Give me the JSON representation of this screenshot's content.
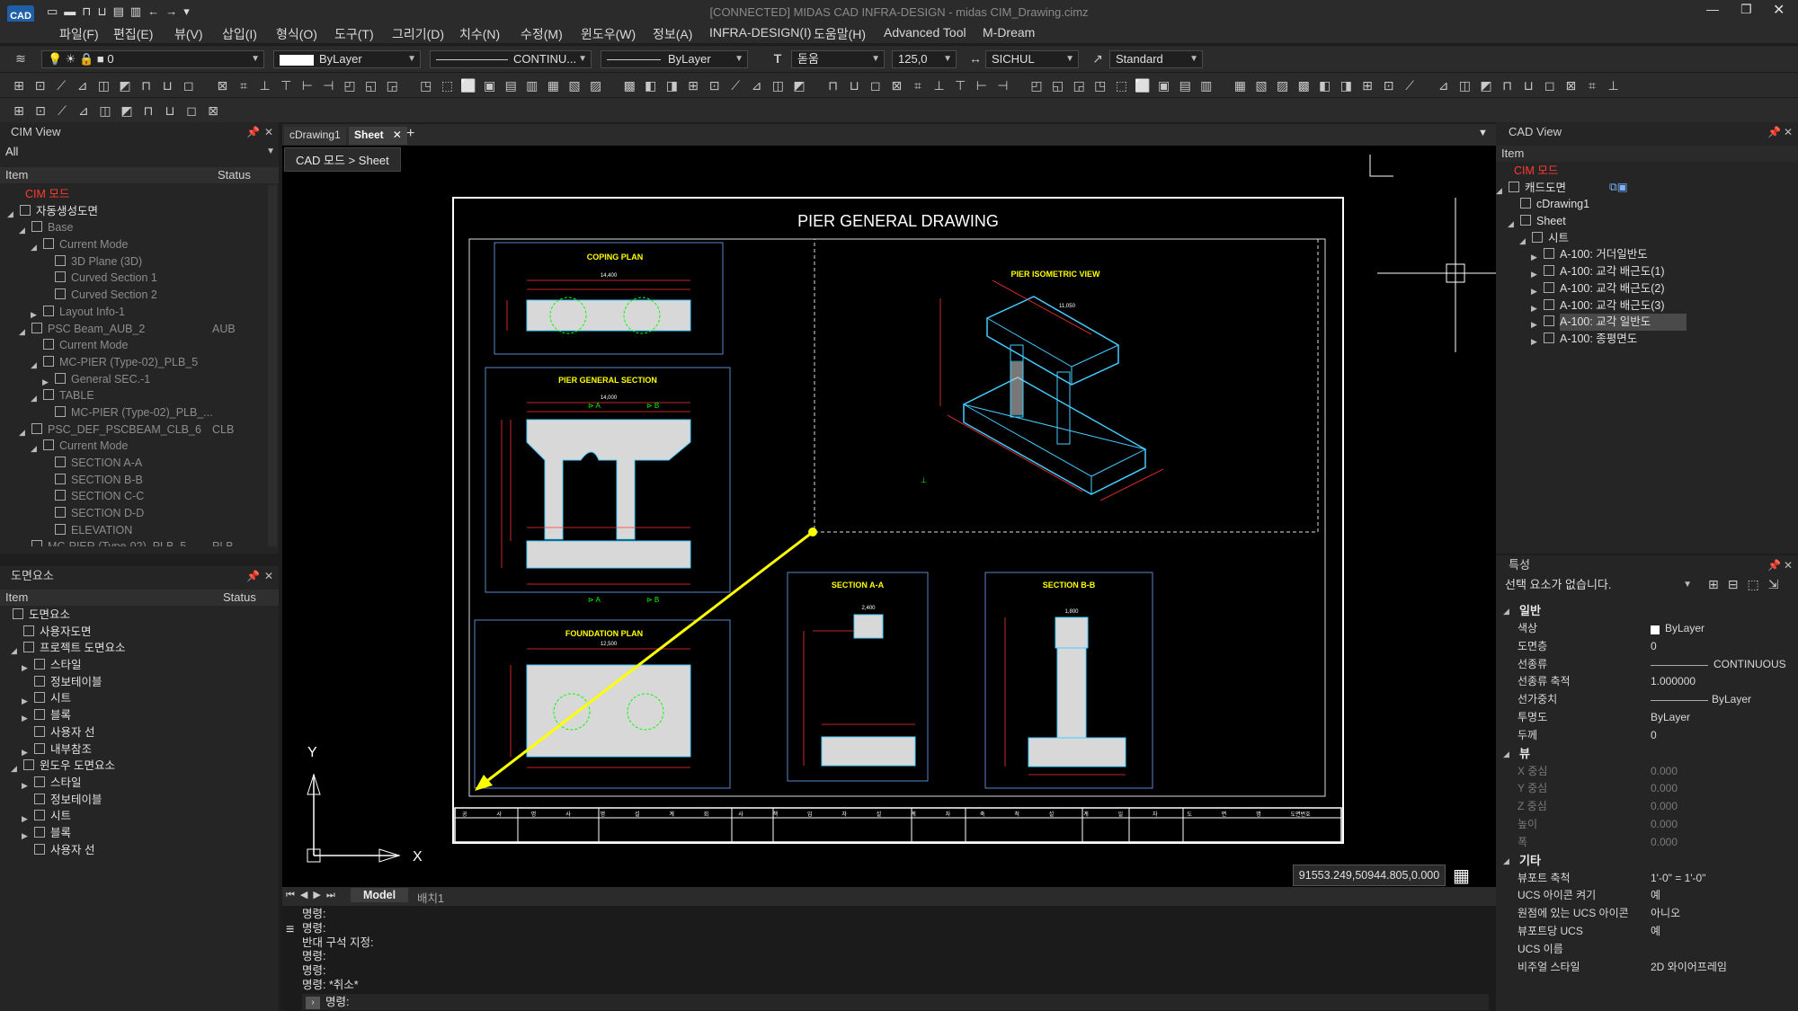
{
  "app": {
    "title": "[CONNECTED] MIDAS CAD INFRA-DESIGN - midas CIM_Drawing.cimz",
    "logo": "CAD"
  },
  "menu": [
    "파일(F)",
    "편집(E)",
    "뷰(V)",
    "삽입(I)",
    "형식(O)",
    "도구(T)",
    "그리기(D)",
    "치수(N)",
    "수정(M)",
    "윈도우(W)",
    "정보(A)",
    "INFRA-DESIGN(I)",
    "도움말(H)",
    "Advanced Tool",
    "M-Dream"
  ],
  "props_toolbar": {
    "layer": "0",
    "color": "ByLayer",
    "linetype": "CONTINU...",
    "lineweight": "ByLayer",
    "textstyle": "돋움",
    "textheight": "125,0",
    "dimstyle": "SICHUL",
    "mlstyle": "Standard"
  },
  "cim_view": {
    "title": "CIM View",
    "filter": "All",
    "col_item": "Item",
    "col_status": "Status",
    "items": [
      {
        "label": "CIM 모드",
        "status": "",
        "level": 1,
        "red": true,
        "tri": "",
        "dim": false
      },
      {
        "label": "자동생성도면",
        "status": "",
        "level": 1,
        "tri": "◢",
        "dim": false
      },
      {
        "label": "Base",
        "status": "",
        "level": 2,
        "tri": "◢",
        "dim": true
      },
      {
        "label": "Current Mode",
        "status": "",
        "level": 3,
        "tri": "◢",
        "dim": true
      },
      {
        "label": "3D Plane (3D)",
        "status": "",
        "level": 4,
        "tri": "",
        "dim": true
      },
      {
        "label": "Curved Section 1",
        "status": "",
        "level": 4,
        "tri": "",
        "dim": true
      },
      {
        "label": "Curved Section 2",
        "status": "",
        "level": 4,
        "tri": "",
        "dim": true
      },
      {
        "label": "Layout Info-1",
        "status": "",
        "level": 3,
        "tri": "▶",
        "dim": true
      },
      {
        "label": "PSC Beam_AUB_2",
        "status": "AUB",
        "level": 2,
        "tri": "◢",
        "dim": true
      },
      {
        "label": "Current Mode",
        "status": "",
        "level": 3,
        "tri": "",
        "dim": true
      },
      {
        "label": "MC-PIER (Type-02)_PLB_5",
        "status": "",
        "level": 3,
        "tri": "◢",
        "dim": true
      },
      {
        "label": "General SEC.-1",
        "status": "",
        "level": 4,
        "tri": "▶",
        "dim": true
      },
      {
        "label": "TABLE",
        "status": "",
        "level": 3,
        "tri": "◢",
        "dim": true
      },
      {
        "label": "MC-PIER (Type-02)_PLB_...",
        "status": "",
        "level": 4,
        "tri": "",
        "dim": true
      },
      {
        "label": "PSC_DEF_PSCBEAM_CLB_6",
        "status": "CLB",
        "level": 2,
        "tri": "◢",
        "dim": true
      },
      {
        "label": "Current Mode",
        "status": "",
        "level": 3,
        "tri": "◢",
        "dim": true
      },
      {
        "label": "SECTION A-A",
        "status": "",
        "level": 4,
        "tri": "",
        "dim": true
      },
      {
        "label": "SECTION B-B",
        "status": "",
        "level": 4,
        "tri": "",
        "dim": true
      },
      {
        "label": "SECTION C-C",
        "status": "",
        "level": 4,
        "tri": "",
        "dim": true
      },
      {
        "label": "SECTION D-D",
        "status": "",
        "level": 4,
        "tri": "",
        "dim": true
      },
      {
        "label": "ELEVATION",
        "status": "",
        "level": 4,
        "tri": "",
        "dim": true
      },
      {
        "label": "MC-PIER (Type-02)_PLB_5",
        "status": "PLB",
        "level": 2,
        "tri": "◢",
        "dim": true
      }
    ]
  },
  "elem_panel": {
    "title": "도면요소",
    "col_item": "Item",
    "col_status": "Status",
    "items": [
      {
        "label": "도면요소",
        "level": 1,
        "tri": ""
      },
      {
        "label": "사용자도면",
        "level": 2,
        "tri": ""
      },
      {
        "label": "프로젝트 도면요소",
        "level": 2,
        "tri": "◢"
      },
      {
        "label": "스타일",
        "level": 3,
        "tri": "▶"
      },
      {
        "label": "정보테이블",
        "level": 3,
        "tri": ""
      },
      {
        "label": "시트",
        "level": 3,
        "tri": "▶"
      },
      {
        "label": "블록",
        "level": 3,
        "tri": "▶"
      },
      {
        "label": "사용자 선",
        "level": 3,
        "tri": ""
      },
      {
        "label": "내부참조",
        "level": 3,
        "tri": "▶"
      },
      {
        "label": "윈도우 도면요소",
        "level": 2,
        "tri": "◢"
      },
      {
        "label": "스타일",
        "level": 3,
        "tri": "▶"
      },
      {
        "label": "정보테이블",
        "level": 3,
        "tri": ""
      },
      {
        "label": "시트",
        "level": 3,
        "tri": "▶"
      },
      {
        "label": "블록",
        "level": 3,
        "tri": "▶"
      },
      {
        "label": "사용자 선",
        "level": 3,
        "tri": ""
      }
    ]
  },
  "doc_tabs": {
    "tabs": [
      "cDrawing1",
      "Sheet"
    ],
    "add": "+",
    "active": 1
  },
  "breadcrumb": "CAD 모드 > Sheet",
  "drawing": {
    "title": "PIER GENERAL DRAWING",
    "views": [
      "COPING PLAN",
      "PIER GENERAL SECTION",
      "FOUNDATION PLAN",
      "PIER ISOMETRIC VIEW",
      "SECTION A-A",
      "SECTION B-B"
    ],
    "dims": [
      "14,400",
      "14,000",
      "12,500",
      "11,050",
      "2,400",
      "1,800",
      "9,000",
      "2,300"
    ],
    "titleblock": [
      "공",
      "사",
      "명",
      "사",
      "명",
      "설",
      "계",
      "회",
      "사",
      "책",
      "임",
      "자",
      "설",
      "계",
      "자",
      "축",
      "척",
      "설",
      "계",
      "일",
      "자",
      "도",
      "면",
      "명",
      "도면번호"
    ]
  },
  "coords": "91553.249,50944.805,0.000",
  "layout_tabs": {
    "tabs": [
      "Model",
      "배치1"
    ]
  },
  "command": {
    "lines": [
      "명령:",
      "명령:",
      "반대 구석 지정:",
      "명령:",
      "명령:",
      "명령: *취소*"
    ],
    "prompt": "명령:"
  },
  "cad_view": {
    "title": "CAD View",
    "col_item": "Item",
    "items": [
      {
        "label": "CIM 모드",
        "level": 1,
        "red": true,
        "tri": ""
      },
      {
        "label": "캐드도면",
        "level": 1,
        "tri": "◢"
      },
      {
        "label": "cDrawing1",
        "level": 2,
        "tri": ""
      },
      {
        "label": "Sheet",
        "level": 2,
        "tri": "◢"
      },
      {
        "label": "시트",
        "level": 3,
        "tri": "◢"
      },
      {
        "label": "A-100: 거더일반도",
        "level": 4,
        "tri": "▶"
      },
      {
        "label": "A-100: 교각 배근도(1)",
        "level": 4,
        "tri": "▶"
      },
      {
        "label": "A-100: 교각 배근도(2)",
        "level": 4,
        "tri": "▶"
      },
      {
        "label": "A-100: 교각 배근도(3)",
        "level": 4,
        "tri": "▶"
      },
      {
        "label": "A-100: 교각 일반도",
        "level": 4,
        "tri": "▶",
        "selected": true
      },
      {
        "label": "A-100: 종평면도",
        "level": 4,
        "tri": "▶"
      }
    ]
  },
  "properties": {
    "title": "특성",
    "selection": "선택 요소가 없습니다.",
    "groups": [
      {
        "name": "일반",
        "rows": [
          [
            "색상",
            "ByLayer"
          ],
          [
            "도면층",
            "0"
          ],
          [
            "선종류",
            "CONTINUOUS"
          ],
          [
            "선종류 축적",
            "1.000000"
          ],
          [
            "선가중치",
            "ByLayer"
          ],
          [
            "투명도",
            "ByLayer"
          ],
          [
            "두께",
            "0"
          ]
        ]
      },
      {
        "name": "뷰",
        "rows": [
          [
            "X 중심",
            "0.000"
          ],
          [
            "Y 중심",
            "0.000"
          ],
          [
            "Z 중심",
            "0.000"
          ],
          [
            "높이",
            "0.000"
          ],
          [
            "폭",
            "0.000"
          ]
        ]
      },
      {
        "name": "기타",
        "rows": [
          [
            "뷰포트 축척",
            "1'-0\" = 1'-0\""
          ],
          [
            "UCS 아이콘 켜기",
            "예"
          ],
          [
            "원점에 있는 UCS 아이콘",
            "아니오"
          ],
          [
            "뷰포트당 UCS",
            "예"
          ],
          [
            "UCS 이름",
            ""
          ],
          [
            "비주얼 스타일",
            "2D 와이어프레임"
          ]
        ]
      }
    ]
  },
  "ucs": {
    "x": "X",
    "y": "Y"
  }
}
